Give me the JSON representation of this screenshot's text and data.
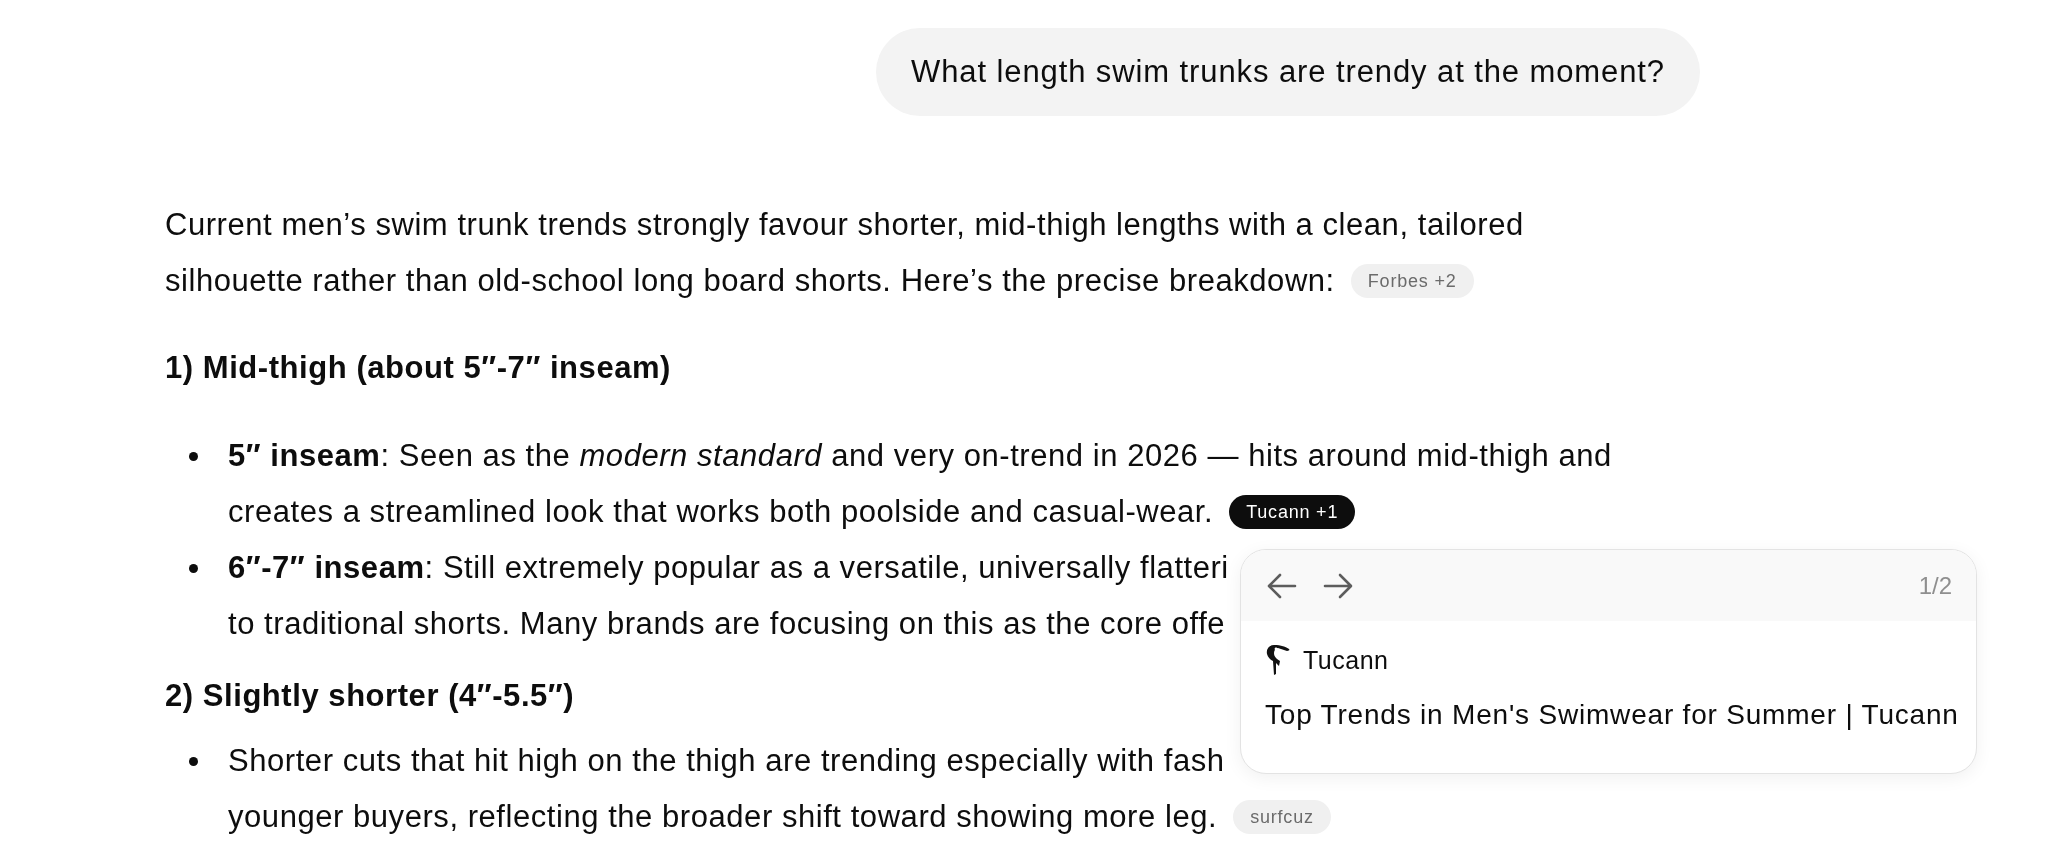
{
  "user_message": {
    "text": "What length swim trunks are trendy at the moment?"
  },
  "answer": {
    "blocks": [
      {
        "kind": "paragraph",
        "lines": [
          "Current men’s swim trunk trends strongly favour shorter, mid-thigh lengths with a clean, tailored",
          "silhouette rather than old-school long board shorts. Here’s the precise breakdown:"
        ],
        "citation": {
          "label": "Forbes +2",
          "selected": false
        }
      },
      {
        "kind": "heading",
        "text": "1) Mid-thigh (about 5″-7″ inseam)"
      },
      {
        "kind": "bullets",
        "items": [
          {
            "lines": [
              "**5″ inseam**: Seen as the *modern standard* and very on-trend in 2026 — hits around mid-thigh and",
              "creates a streamlined look that works both poolside and casual-wear."
            ],
            "citation": {
              "label": "Tucann +1",
              "selected": true
            }
          },
          {
            "lines": [
              "**6″-7″ inseam**: Still extremely popular as a versatile, universally flatteri",
              "to traditional shorts. Many brands are focusing on this as the core offe"
            ]
          }
        ]
      },
      {
        "kind": "heading",
        "text": "2) Slightly shorter (4″-5.5″)"
      },
      {
        "kind": "bullets",
        "items": [
          {
            "lines": [
              "Shorter cuts that hit high on the thigh are trending especially with fash",
              "younger buyers, reflecting the broader shift toward showing more leg."
            ],
            "citation": {
              "label": "surfcuz",
              "selected": false
            }
          }
        ]
      }
    ]
  },
  "citation_popover": {
    "page": "1/2",
    "source": "Tucann",
    "title": "Top Trends in Men's Swimwear for Summer | Tucann"
  }
}
